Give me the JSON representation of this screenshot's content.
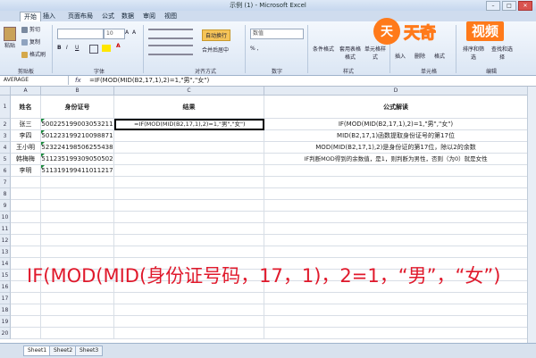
{
  "window": {
    "title": "示例 (1) - Microsoft Excel",
    "min": "–",
    "max": "□",
    "close": "✕"
  },
  "tabs": [
    "开始",
    "插入",
    "页面布局",
    "公式",
    "数据",
    "审阅",
    "视图"
  ],
  "ribbon": {
    "paste": "粘贴",
    "cut": "剪切",
    "copy": "复制",
    "format_painter": "格式刷",
    "font_size": "10",
    "wrap_text": "自动换行",
    "merge_center": "合并后居中",
    "number_format": "数值",
    "conditional_format": "条件格式",
    "table_format": "套用表格格式",
    "cell_style": "单元格样式",
    "insert": "插入",
    "delete": "删除",
    "format": "格式",
    "sort_filter": "排序和筛选",
    "find_select": "查找和选择",
    "groups": {
      "clipboard": "剪贴板",
      "font": "字体",
      "alignment": "对齐方式",
      "number": "数字",
      "styles": "样式",
      "cells": "单元格",
      "editing": "编辑"
    }
  },
  "watermark": {
    "circle": "天",
    "brand": "天奇",
    "badge": "视频"
  },
  "formula_bar": {
    "name_box": "AVERAGE",
    "fx": "fx",
    "formula": "=IF(MOD(MID(B2,17,1),2)=1,\"男\",\"女\")"
  },
  "columns": [
    "A",
    "B",
    "C",
    "D"
  ],
  "headers": {
    "name": "姓名",
    "id": "身份证号",
    "result": "结果",
    "explain": "公式解读"
  },
  "rows": [
    {
      "num": "2",
      "name": "张三",
      "id": "500225199003053211",
      "result": "=IF(MOD(MID(B2,17,1),2)=1,\"男\",\"女\")",
      "explain": "IF(MOD(MID(B2,17,1),2)=1,\"男\",\"女\")"
    },
    {
      "num": "3",
      "name": "李四",
      "id": "501223199210098871",
      "result": "",
      "explain": "MID(B2,17,1)函数提取身份证号的第17位"
    },
    {
      "num": "4",
      "name": "王小明",
      "id": "523224198506255438",
      "result": "",
      "explain": "MOD(MID(B2,17,1),2)是身份证的第17位，除以2的余数"
    },
    {
      "num": "5",
      "name": "韩梅梅",
      "id": "511235199309050502",
      "result": "",
      "explain": "IF判断MOD得到的余数值，是1，则判断为男性，否则（为0）就是女性"
    },
    {
      "num": "6",
      "name": "李明",
      "id": "511319199411011217",
      "result": "",
      "explain": ""
    }
  ],
  "empty_rows": [
    "7",
    "8",
    "9",
    "10",
    "11",
    "12",
    "13",
    "14",
    "15",
    "16",
    "17",
    "18",
    "19",
    "20"
  ],
  "overlay_caption": "IF(MOD(MID(身份证号码，17，1)，2=1，“男”，“女”)",
  "sheets": [
    "Sheet1",
    "Sheet2",
    "Sheet3"
  ],
  "colors": {
    "accent": "#ff7a1a",
    "caption": "#e0192b",
    "ribbon": "#dbe6f4"
  }
}
